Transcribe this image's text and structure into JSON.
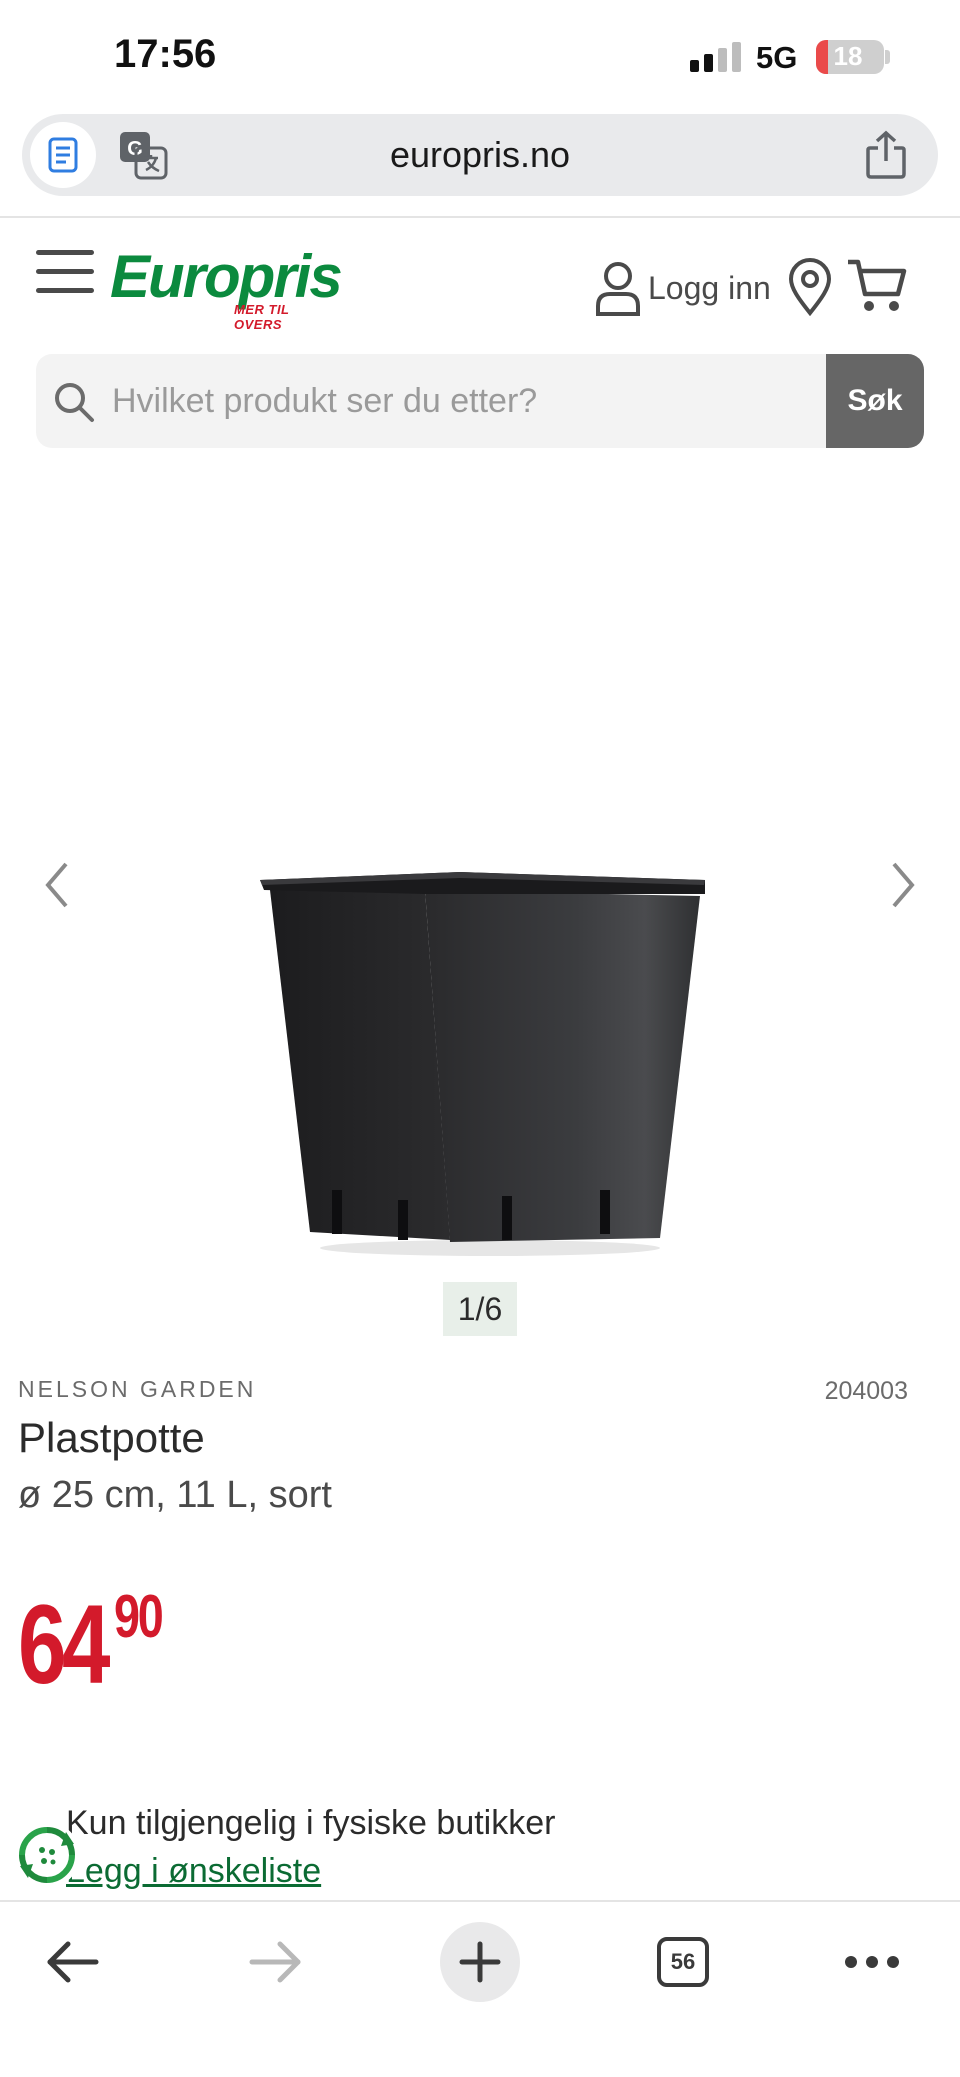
{
  "status_bar": {
    "time": "17:56",
    "network": "5G",
    "battery": "18",
    "battery_level": 0.18
  },
  "browser": {
    "url": "europris.no",
    "icons": [
      "reader-icon",
      "translate-icon",
      "share-icon"
    ]
  },
  "header": {
    "logo_text": "Europris",
    "logo_tagline": "MER TIL OVERS",
    "login_label": "Logg inn",
    "icons": [
      "menu-icon",
      "user-icon",
      "location-pin-icon",
      "cart-icon"
    ]
  },
  "search": {
    "placeholder": "Hvilket produkt ser du etter?",
    "button_label": "Søk"
  },
  "gallery": {
    "counter": "1/6",
    "current": 1,
    "total": 6
  },
  "product": {
    "brand": "NELSON GARDEN",
    "sku": "204003",
    "title": "Plastpotte",
    "subtitle": "ø 25 cm, 11 L, sort",
    "price_major": "64",
    "price_minor": "90",
    "availability": "Kun tilgjengelig i fysiske butikker",
    "wishlist_label": "Legg i ønskeliste"
  },
  "toolbar": {
    "tab_count": "56",
    "icons": [
      "back-arrow-icon",
      "forward-arrow-icon",
      "new-tab-plus-icon",
      "tabs-icon",
      "more-icon"
    ]
  },
  "colors": {
    "brand_green": "#0b8a3e",
    "price_red": "#d31a2b",
    "search_button": "#666666"
  }
}
